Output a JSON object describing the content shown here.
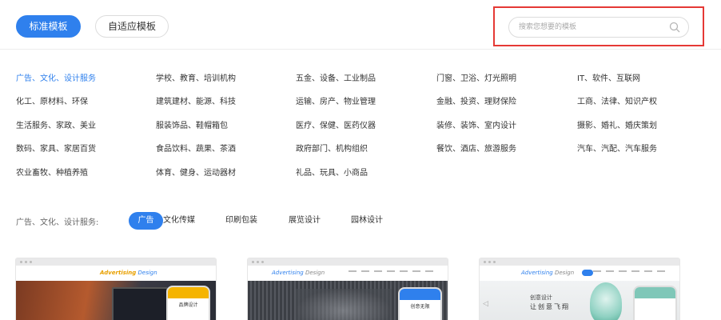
{
  "header": {
    "tabs": [
      {
        "label": "标准模板",
        "active": true
      },
      {
        "label": "自适应模板",
        "active": false
      }
    ],
    "search": {
      "placeholder": "搜索您想要的模板"
    }
  },
  "categories": {
    "rows": [
      [
        "广告、文化、设计服务",
        "学校、教育、培训机构",
        "五金、设备、工业制品",
        "门窗、卫浴、灯光照明",
        "IT、软件、互联网"
      ],
      [
        "化工、原材料、环保",
        "建筑建材、能源、科技",
        "运输、房产、物业管理",
        "金融、投资、理财保险",
        "工商、法律、知识产权"
      ],
      [
        "生活服务、家政、美业",
        "服装饰品、鞋帽箱包",
        "医疗、保健、医药仪器",
        "装修、装饰、室内设计",
        "摄影、婚礼、婚庆策划"
      ],
      [
        "数码、家具、家居百货",
        "食品饮料、蔬果、茶酒",
        "政府部门、机构组织",
        "餐饮、酒店、旅游服务",
        "汽车、汽配、汽车服务"
      ],
      [
        "农业畜牧、种植养殖",
        "体育、健身、运动器材",
        "礼品、玩具、小商品"
      ]
    ],
    "selected": "广告、文化、设计服务"
  },
  "filter": {
    "label": "广告、文化、设计服务:",
    "chips": [
      {
        "label": "广告",
        "active": true
      },
      {
        "label": "文化传媒",
        "active": false
      },
      {
        "label": "印刷包装",
        "active": false
      },
      {
        "label": "展览设计",
        "active": false
      },
      {
        "label": "园林设计",
        "active": false
      }
    ]
  },
  "templates": [
    {
      "logo_a": "Advertising",
      "logo_b": "Design",
      "phone_text": "品牌设计"
    },
    {
      "logo_a": "Advertising",
      "logo_b": "Design",
      "phone_text": "创意无限"
    },
    {
      "logo_a": "Advertising",
      "logo_b": "Design",
      "hero_text": "让创意飞翔",
      "hero_sub": "创意设计"
    }
  ],
  "colors": {
    "accent": "#2f80ed",
    "highlight": "#e53935"
  }
}
